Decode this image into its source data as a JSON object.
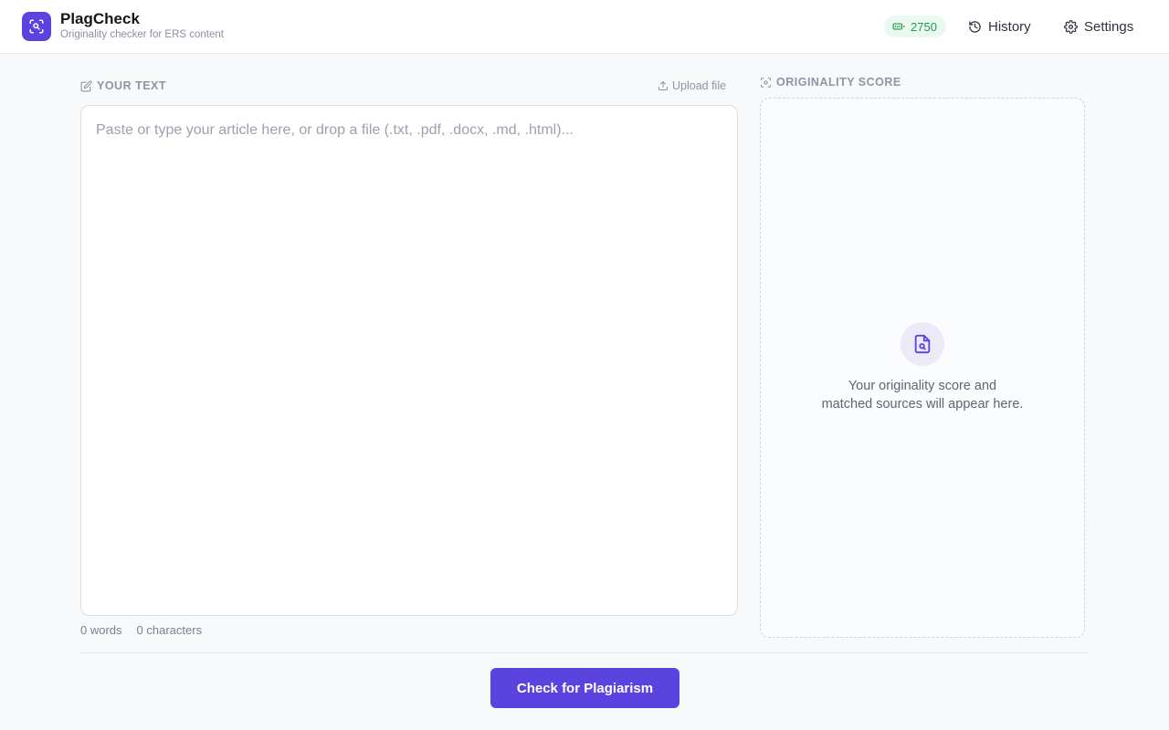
{
  "app": {
    "name": "PlagCheck",
    "subtitle": "Originality checker for ERS content"
  },
  "header": {
    "credits": "2750",
    "history_label": "History",
    "settings_label": "Settings"
  },
  "editor": {
    "section_label": "YOUR TEXT",
    "upload_label": "Upload file",
    "placeholder": "Paste or type your article here, or drop a file (.txt, .pdf, .docx, .md, .html)...",
    "value": "",
    "word_count": "0 words",
    "char_count": "0 characters"
  },
  "score": {
    "section_label": "ORIGINALITY SCORE",
    "empty_line1": "Your originality score and",
    "empty_line2": "matched sources will appear here."
  },
  "actions": {
    "check_label": "Check for Plagiarism"
  },
  "icons": {
    "logo": "scan-search-icon",
    "credits": "battery-icon",
    "history": "history-icon",
    "settings": "gear-icon",
    "text": "edit-icon",
    "upload": "upload-icon",
    "score": "scan-icon",
    "empty": "file-search-icon"
  },
  "colors": {
    "accent": "#5b43e0",
    "credits_bg": "#ebf8ef",
    "credits_fg": "#1f9d4a"
  }
}
